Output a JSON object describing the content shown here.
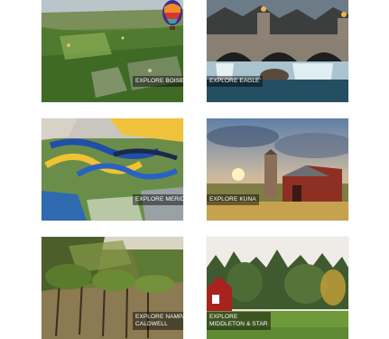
{
  "cards": [
    {
      "label": "EXPLORE BOISE"
    },
    {
      "label": "EXPLORE EAGLE"
    },
    {
      "label": "EXPLORE MERIDIAN"
    },
    {
      "label": "EXPLORE KUNA"
    },
    {
      "label_line1": "EXPLORE NAMPA &",
      "label_line2": "CALDWELL"
    },
    {
      "label_line1": "EXPLORE",
      "label_line2": "MIDDLETON & STAR"
    }
  ]
}
